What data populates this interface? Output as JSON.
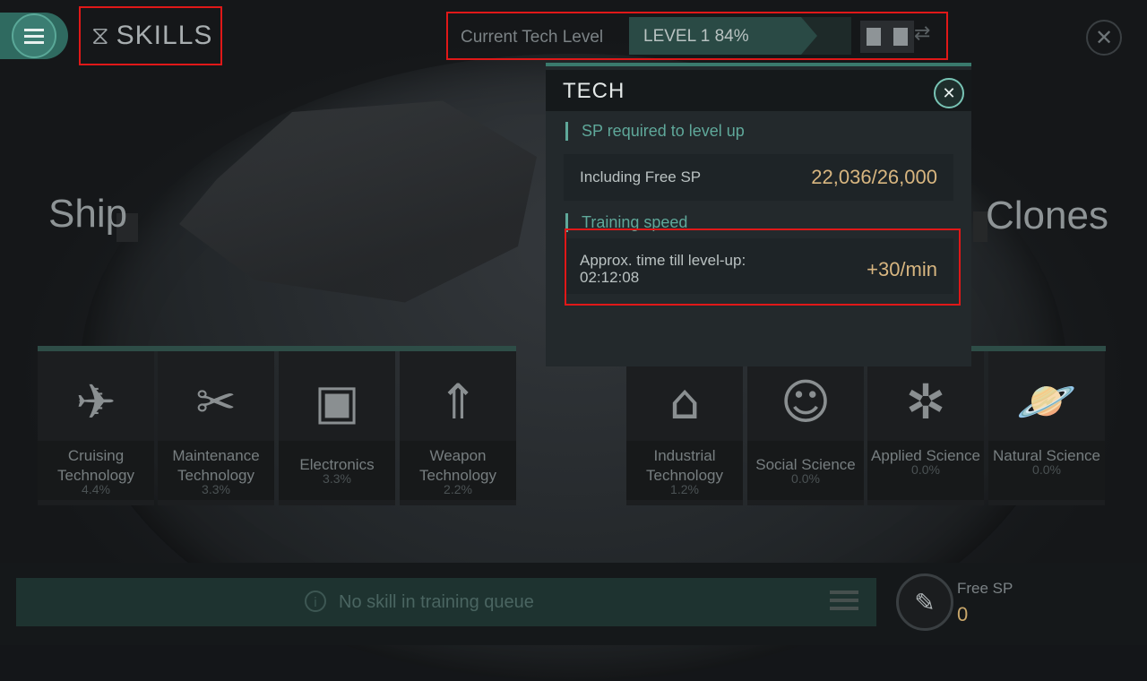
{
  "header": {
    "title": "SKILLS",
    "tech_level_label": "Current Tech Level",
    "tech_level_value": "LEVEL 1 84%",
    "tech_progress": 0.84
  },
  "sides": {
    "left": "Ship",
    "right": "Clones"
  },
  "categories_left": [
    {
      "name": "Cruising Technology",
      "pct": "4.4%",
      "icon": "ship-icon"
    },
    {
      "name": "Maintenance Technology",
      "pct": "3.3%",
      "icon": "wrench-screwdriver-icon"
    },
    {
      "name": "Electronics",
      "pct": "3.3%",
      "icon": "chip-icon"
    },
    {
      "name": "Weapon Technology",
      "pct": "2.2%",
      "icon": "missiles-icon"
    }
  ],
  "categories_right": [
    {
      "name": "Industrial Technology",
      "pct": "1.2%",
      "icon": "factory-icon"
    },
    {
      "name": "Social Science",
      "pct": "0.0%",
      "icon": "person-icon"
    },
    {
      "name": "Applied Science",
      "pct": "0.0%",
      "icon": "atom-icon"
    },
    {
      "name": "Natural Science",
      "pct": "0.0%",
      "icon": "planet-icon"
    }
  ],
  "popup": {
    "title": "TECH",
    "sp_section": "SP required to level up",
    "free_sp_label": "Including Free SP",
    "free_sp_value": "22,036/26,000",
    "speed_section": "Training speed",
    "approx_label": "Approx. time till level-up:",
    "approx_time": "02:12:08",
    "speed_value": "+30/min"
  },
  "bottom": {
    "queue_message": "No skill in training queue",
    "free_sp_label": "Free SP",
    "free_sp_value": "0"
  },
  "colors": {
    "accent": "#3a7a6d",
    "highlight": "#e01818",
    "value_gold": "#d8b680"
  }
}
